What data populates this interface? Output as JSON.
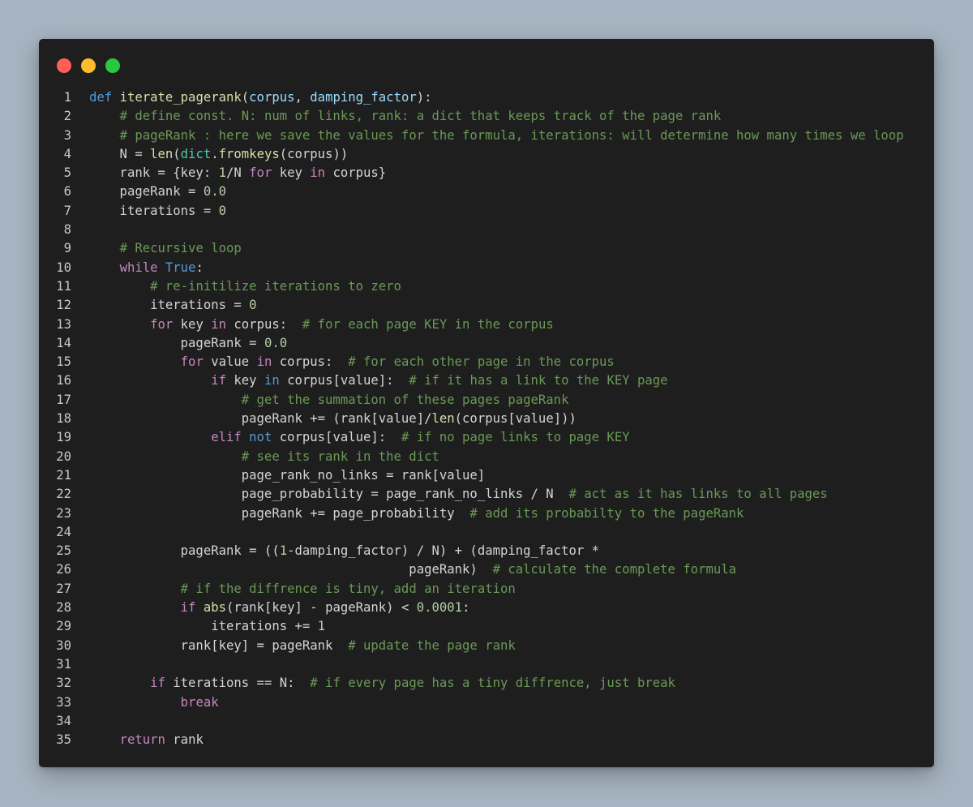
{
  "window": {
    "controls": [
      {
        "name": "close",
        "color": "#ff5f57"
      },
      {
        "name": "minimize",
        "color": "#febc2e"
      },
      {
        "name": "maximize",
        "color": "#28c840"
      }
    ]
  },
  "colors": {
    "background": "#a6b3c0",
    "editor_bg": "#1e1e1e",
    "keyword_blue": "#569cd6",
    "keyword_purple": "#c586c0",
    "function": "#dcdcaa",
    "parameter": "#9cdcfe",
    "comment": "#6a9955",
    "number": "#b5cea8",
    "builtin": "#4ec9b0",
    "text": "#d4d4d4"
  },
  "code": {
    "lines": [
      {
        "n": "1",
        "tokens": [
          [
            "kw",
            "def "
          ],
          [
            "fn",
            "iterate_pagerank"
          ],
          [
            "txt",
            "("
          ],
          [
            "param",
            "corpus"
          ],
          [
            "txt",
            ", "
          ],
          [
            "param",
            "damping_factor"
          ],
          [
            "txt",
            "):"
          ]
        ]
      },
      {
        "n": "2",
        "tokens": [
          [
            "txt",
            "    "
          ],
          [
            "cm",
            "# define const. N: num of links, rank: a dict that keeps track of the page rank"
          ]
        ]
      },
      {
        "n": "3",
        "tokens": [
          [
            "txt",
            "    "
          ],
          [
            "cm",
            "# pageRank : here we save the values for the formula, iterations: will determine how many times we loop"
          ]
        ]
      },
      {
        "n": "4",
        "tokens": [
          [
            "txt",
            "    N = "
          ],
          [
            "fn",
            "len"
          ],
          [
            "txt",
            "("
          ],
          [
            "bi",
            "dict"
          ],
          [
            "txt",
            "."
          ],
          [
            "fn",
            "fromkeys"
          ],
          [
            "txt",
            "(corpus))"
          ]
        ]
      },
      {
        "n": "5",
        "tokens": [
          [
            "txt",
            "    rank = {key: "
          ],
          [
            "num",
            "1"
          ],
          [
            "txt",
            "/N "
          ],
          [
            "kw2",
            "for"
          ],
          [
            "txt",
            " key "
          ],
          [
            "kw2",
            "in"
          ],
          [
            "txt",
            " corpus}"
          ]
        ]
      },
      {
        "n": "6",
        "tokens": [
          [
            "txt",
            "    pageRank = "
          ],
          [
            "num",
            "0.0"
          ]
        ]
      },
      {
        "n": "7",
        "tokens": [
          [
            "txt",
            "    iterations = "
          ],
          [
            "num",
            "0"
          ]
        ]
      },
      {
        "n": "8",
        "tokens": [
          [
            "txt",
            ""
          ]
        ]
      },
      {
        "n": "9",
        "tokens": [
          [
            "txt",
            "    "
          ],
          [
            "cm",
            "# Recursive loop"
          ]
        ]
      },
      {
        "n": "10",
        "tokens": [
          [
            "txt",
            "    "
          ],
          [
            "kw2",
            "while"
          ],
          [
            "txt",
            " "
          ],
          [
            "kw",
            "True"
          ],
          [
            "txt",
            ":"
          ]
        ]
      },
      {
        "n": "11",
        "tokens": [
          [
            "txt",
            "        "
          ],
          [
            "cm",
            "# re-initilize iterations to zero"
          ]
        ]
      },
      {
        "n": "12",
        "tokens": [
          [
            "txt",
            "        iterations = "
          ],
          [
            "num",
            "0"
          ]
        ]
      },
      {
        "n": "13",
        "tokens": [
          [
            "txt",
            "        "
          ],
          [
            "kw2",
            "for"
          ],
          [
            "txt",
            " key "
          ],
          [
            "kw2",
            "in"
          ],
          [
            "txt",
            " corpus:  "
          ],
          [
            "cm",
            "# for each page KEY in the corpus"
          ]
        ]
      },
      {
        "n": "14",
        "tokens": [
          [
            "txt",
            "            pageRank = "
          ],
          [
            "num",
            "0.0"
          ]
        ]
      },
      {
        "n": "15",
        "tokens": [
          [
            "txt",
            "            "
          ],
          [
            "kw2",
            "for"
          ],
          [
            "txt",
            " value "
          ],
          [
            "kw2",
            "in"
          ],
          [
            "txt",
            " corpus:  "
          ],
          [
            "cm",
            "# for each other page in the corpus"
          ]
        ]
      },
      {
        "n": "16",
        "tokens": [
          [
            "txt",
            "                "
          ],
          [
            "kw2",
            "if"
          ],
          [
            "txt",
            " key "
          ],
          [
            "kw",
            "in"
          ],
          [
            "txt",
            " corpus[value]:  "
          ],
          [
            "cm",
            "# if it has a link to the KEY page"
          ]
        ]
      },
      {
        "n": "17",
        "tokens": [
          [
            "txt",
            "                    "
          ],
          [
            "cm",
            "# get the summation of these pages pageRank"
          ]
        ]
      },
      {
        "n": "18",
        "tokens": [
          [
            "txt",
            "                    pageRank += (rank[value]/"
          ],
          [
            "fn",
            "len"
          ],
          [
            "txt",
            "(corpus[value]))"
          ]
        ]
      },
      {
        "n": "19",
        "tokens": [
          [
            "txt",
            "                "
          ],
          [
            "kw2",
            "elif"
          ],
          [
            "txt",
            " "
          ],
          [
            "kw",
            "not"
          ],
          [
            "txt",
            " corpus[value]:  "
          ],
          [
            "cm",
            "# if no page links to page KEY"
          ]
        ]
      },
      {
        "n": "20",
        "tokens": [
          [
            "txt",
            "                    "
          ],
          [
            "cm",
            "# see its rank in the dict"
          ]
        ]
      },
      {
        "n": "21",
        "tokens": [
          [
            "txt",
            "                    page_rank_no_links = rank[value]"
          ]
        ]
      },
      {
        "n": "22",
        "tokens": [
          [
            "txt",
            "                    page_probability = page_rank_no_links / N  "
          ],
          [
            "cm",
            "# act as it has links to all pages"
          ]
        ]
      },
      {
        "n": "23",
        "tokens": [
          [
            "txt",
            "                    pageRank += page_probability  "
          ],
          [
            "cm",
            "# add its probabilty to the pageRank"
          ]
        ]
      },
      {
        "n": "24",
        "tokens": [
          [
            "txt",
            ""
          ]
        ]
      },
      {
        "n": "25",
        "tokens": [
          [
            "txt",
            "            pageRank = (("
          ],
          [
            "num",
            "1"
          ],
          [
            "txt",
            "-damping_factor) / N) + (damping_factor *"
          ]
        ]
      },
      {
        "n": "26",
        "tokens": [
          [
            "txt",
            "                                          pageRank)  "
          ],
          [
            "cm",
            "# calculate the complete formula"
          ]
        ]
      },
      {
        "n": "27",
        "tokens": [
          [
            "txt",
            "            "
          ],
          [
            "cm",
            "# if the diffrence is tiny, add an iteration"
          ]
        ]
      },
      {
        "n": "28",
        "tokens": [
          [
            "txt",
            "            "
          ],
          [
            "kw2",
            "if"
          ],
          [
            "txt",
            " "
          ],
          [
            "fn",
            "abs"
          ],
          [
            "txt",
            "(rank[key] - pageRank) < "
          ],
          [
            "num",
            "0.0001"
          ],
          [
            "txt",
            ":"
          ]
        ]
      },
      {
        "n": "29",
        "tokens": [
          [
            "txt",
            "                iterations += "
          ],
          [
            "num",
            "1"
          ]
        ]
      },
      {
        "n": "30",
        "tokens": [
          [
            "txt",
            "            rank[key] = pageRank  "
          ],
          [
            "cm",
            "# update the page rank"
          ]
        ]
      },
      {
        "n": "31",
        "tokens": [
          [
            "txt",
            ""
          ]
        ]
      },
      {
        "n": "32",
        "tokens": [
          [
            "txt",
            "        "
          ],
          [
            "kw2",
            "if"
          ],
          [
            "txt",
            " iterations == N:  "
          ],
          [
            "cm",
            "# if every page has a tiny diffrence, just break"
          ]
        ]
      },
      {
        "n": "33",
        "tokens": [
          [
            "txt",
            "            "
          ],
          [
            "kw2",
            "break"
          ]
        ]
      },
      {
        "n": "34",
        "tokens": [
          [
            "txt",
            ""
          ]
        ]
      },
      {
        "n": "35",
        "tokens": [
          [
            "txt",
            "    "
          ],
          [
            "kw2",
            "return"
          ],
          [
            "txt",
            " rank"
          ]
        ]
      }
    ]
  }
}
